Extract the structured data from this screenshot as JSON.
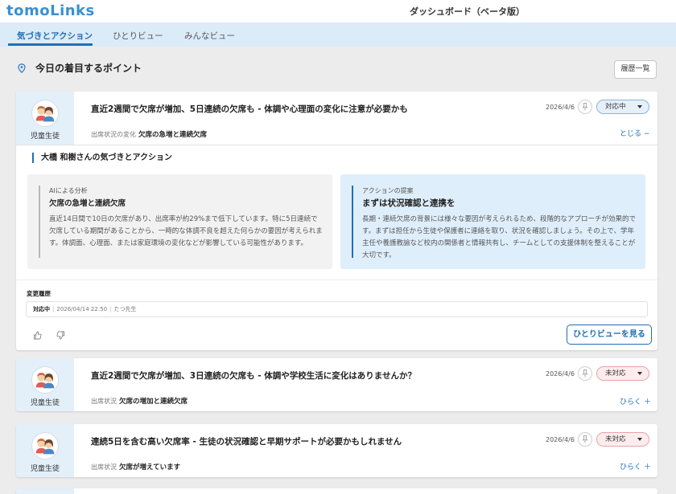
{
  "app": {
    "logo": "tomoLinks",
    "title": "ダッシュボード（ベータ版）"
  },
  "tabs": [
    {
      "label": "気づきとアクション",
      "active": true
    },
    {
      "label": "ひとりビュー",
      "active": false
    },
    {
      "label": "みんなビュー",
      "active": false
    }
  ],
  "section": {
    "title": "今日の着目するポイント",
    "history_button": "履歴一覧"
  },
  "colors": {
    "accent": "#1f6fb6",
    "tab_bg": "#dcebf8",
    "card_side_bg": "#e3eff9",
    "status_in_progress_bg": "#e6f0fb",
    "status_pending_bg": "#fdecee"
  },
  "cards": [
    {
      "side_label": "児童生徒",
      "title": "直近2週間で欠席が増加、5日連続の欠席も - 体調や心理面の変化に注意が必要かも",
      "meta_label": "出席状況の変化",
      "meta_value": "欠席の急増と連続欠席",
      "date": "2026/4/6",
      "status": "対応中",
      "toggle": "とじる −",
      "expanded": {
        "ack_title": "大橋 和樹さんの気づきとアクション",
        "ai_kicker": "AIによる分析",
        "ai_head": "欠席の急増と連続欠席",
        "ai_body": "直近14日間で10日の欠席があり、出席率が約29%まで低下しています。特に5日連続で欠席している期間があることから、一時的な体調不良を超えた何らかの要因が考えられます。体調面、心理面、または家庭環境の変化などが影響している可能性があります。",
        "act_kicker": "アクションの提案",
        "act_head": "まずは状況確認と連携を",
        "act_body": "長期・連続欠席の背景には様々な要因が考えられるため、段階的なアプローチが効果的です。まずは担任から生徒や保護者に連絡を取り、状況を確認しましょう。その上で、学年主任や養護教諭など校内の関係者と情報共有し、チームとしての支援体制を整えることが大切です。",
        "history_label": "変更履歴",
        "history_status": "対応中",
        "history_datetime": "2026/04/14 22:50",
        "history_user": "たつ先生",
        "view_button": "ひとりビューを見る"
      }
    },
    {
      "side_label": "児童生徒",
      "title": "直近2週間で欠席が増加、3日連続の欠席も - 体調や学校生活に変化はありませんか？",
      "meta_label": "出席状況",
      "meta_value": "欠席の増加と連続欠席",
      "date": "2026/4/6",
      "status": "未対応",
      "toggle": "ひらく ＋"
    },
    {
      "side_label": "児童生徒",
      "title": "連続5日を含む高い欠席率 - 生徒の状況確認と早期サポートが必要かもしれません",
      "meta_label": "出席状況",
      "meta_value": "欠席が増えています",
      "date": "2026/4/6",
      "status": "未対応",
      "toggle": "ひらく ＋"
    }
  ],
  "icons": [
    "location-pin-icon",
    "pin-icon",
    "caret-down-icon",
    "thumbs-up-icon",
    "thumbs-down-icon",
    "student-avatar-icon"
  ]
}
